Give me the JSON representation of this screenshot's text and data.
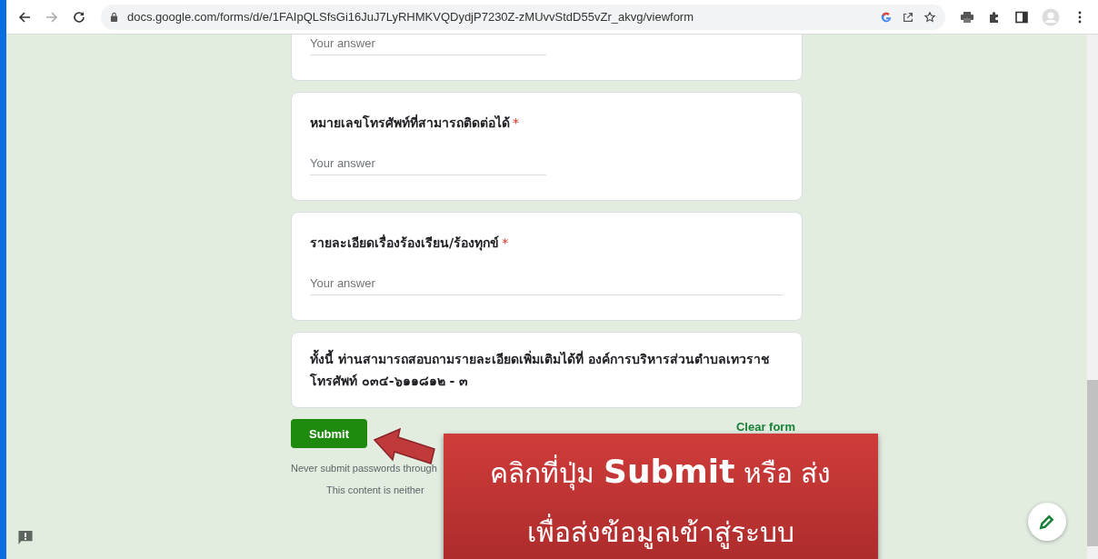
{
  "browser": {
    "url": "docs.google.com/forms/d/e/1FAIpQLSfsGi16JuJ7LyRHMKVQDydjP7230Z-zMUvvStdD55vZr_akvg/viewform"
  },
  "cards": [
    {
      "kind": "short",
      "placeholder": "Your answer"
    },
    {
      "kind": "short",
      "title": "หมายเลขโทรศัพท์ที่สามารถติดต่อได้",
      "required_mark": "*",
      "placeholder": "Your answer"
    },
    {
      "kind": "paragraph",
      "title": "รายละเอียดเรื่องร้องเรียน/ร้องทุกข์",
      "required_mark": "*",
      "placeholder": "Your answer"
    },
    {
      "kind": "note",
      "lines": [
        "ทั้งนี้ ท่านสามารถสอบถามรายละเอียดเพิ่มเติมได้ที่ องค์การบริหารส่วนตำบลเทวราช",
        "โทรศัพท์ ๐๓๔-๖๑๑๘๑๒ - ๓"
      ]
    }
  ],
  "submit_button": "Submit",
  "clear_button": "Clear form",
  "footer": [
    "Never submit passwords through",
    "This content is neither"
  ],
  "callout": {
    "lines": [
      "คลิกที่ปุ่ม **Submit** หรือ ส่ง",
      "เพื่อส่งข้อมูลเข้าสู่ระบบ"
    ]
  }
}
